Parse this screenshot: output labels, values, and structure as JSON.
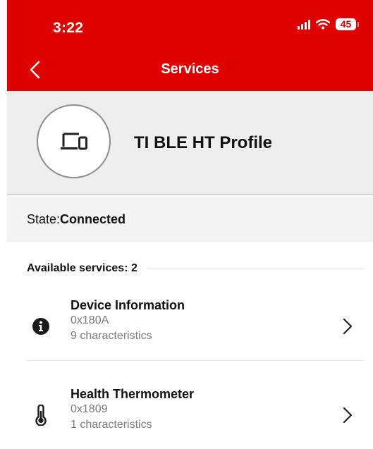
{
  "status_bar": {
    "time": "3:22",
    "battery": "45",
    "icons": [
      "signal-icon",
      "wifi-icon",
      "battery-icon"
    ]
  },
  "nav": {
    "title": "Services",
    "back_icon": "chevron-left-icon"
  },
  "device": {
    "name": "TI BLE HT Profile",
    "icon": "devices-icon"
  },
  "state": {
    "label": "State: ",
    "value": "Connected"
  },
  "services": {
    "header": "Available services: 2",
    "items": [
      {
        "name": "Device Information",
        "uuid": "0x180A",
        "characteristics": "9 characteristics",
        "icon": "info-icon"
      },
      {
        "name": "Health Thermometer",
        "uuid": "0x1809",
        "characteristics": "1 characteristics",
        "icon": "thermometer-icon"
      }
    ]
  },
  "colors": {
    "header_bg": "#df0000",
    "card_bg": "#eeeeee",
    "state_bg": "#f4f4f4"
  }
}
